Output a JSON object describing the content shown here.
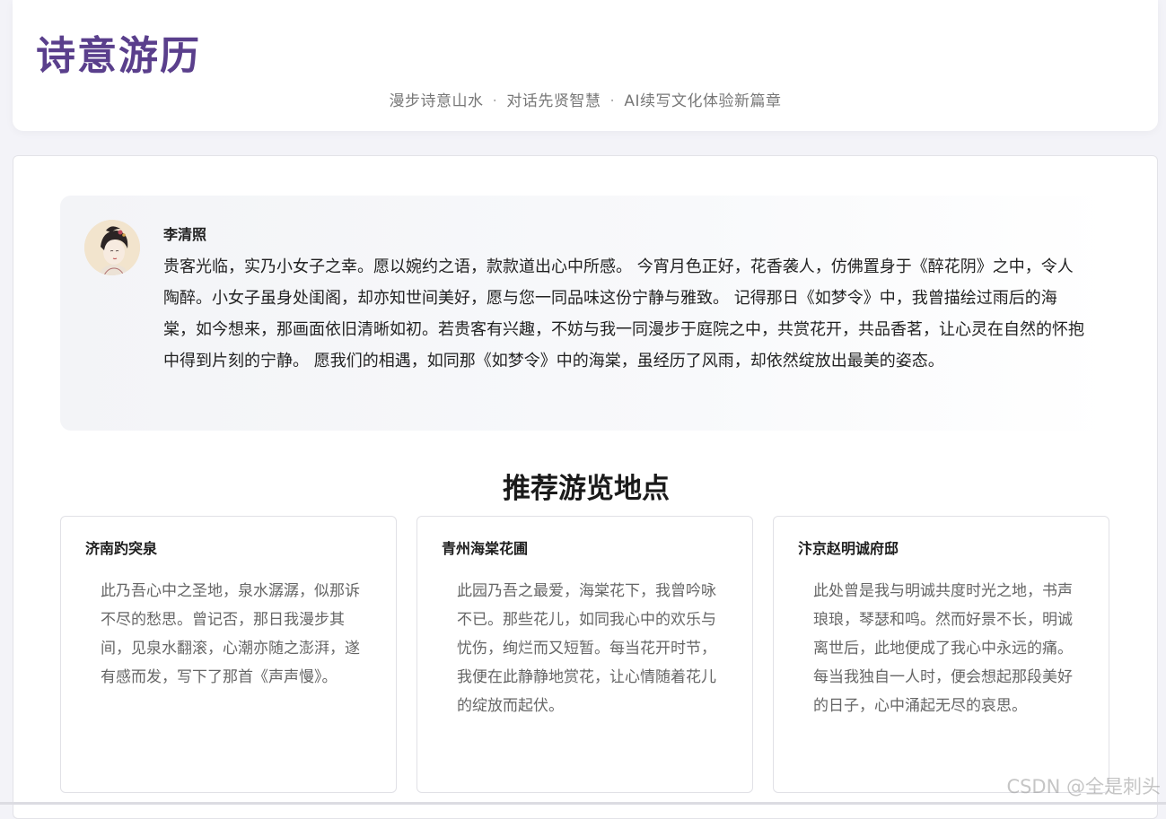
{
  "header": {
    "title": "诗意游历",
    "tagline_items": [
      "漫步诗意山水",
      "对话先贤智慧",
      "AI续写文化体验新篇章"
    ],
    "separator": "·"
  },
  "chat": {
    "speaker": "李清照",
    "avatar_icon": "poet-portrait-avatar",
    "message": "贵客光临，实乃小女子之幸。愿以婉约之语，款款道出心中所感。 今宵月色正好，花香袭人，仿佛置身于《醉花阴》之中，令人陶醉。小女子虽身处闺阁，却亦知世间美好，愿与您一同品味这份宁静与雅致。 记得那日《如梦令》中，我曾描绘过雨后的海棠，如今想来，那画面依旧清晰如初。若贵客有兴趣，不妨与我一同漫步于庭院之中，共赏花开，共品香茗，让心灵在自然的怀抱中得到片刻的宁静。 愿我们的相遇，如同那《如梦令》中的海棠，虽经历了风雨，却依然绽放出最美的姿态。"
  },
  "recommend": {
    "title": "推荐游览地点",
    "places": [
      {
        "name": "济南趵突泉",
        "desc": "此乃吾心中之圣地，泉水潺潺，似那诉不尽的愁思。曾记否，那日我漫步其间，见泉水翻滚，心潮亦随之澎湃，遂有感而发，写下了那首《声声慢》。"
      },
      {
        "name": "青州海棠花圃",
        "desc": "此园乃吾之最爱，海棠花下，我曾吟咏不已。那些花儿，如同我心中的欢乐与忧伤，绚烂而又短暂。每当花开时节，我便在此静静地赏花，让心情随着花儿的绽放而起伏。"
      },
      {
        "name": "汴京赵明诚府邸",
        "desc": "此处曾是我与明诚共度时光之地，书声琅琅，琴瑟和鸣。然而好景不长，明诚离世后，此地便成了我心中永远的痛。每当我独自一人时，便会想起那段美好的日子，心中涌起无尽的哀思。"
      }
    ]
  },
  "watermark": "CSDN @全是刺头",
  "colors": {
    "brand_purple": "#5a3f8c",
    "page_bg": "#f3f3f8"
  }
}
